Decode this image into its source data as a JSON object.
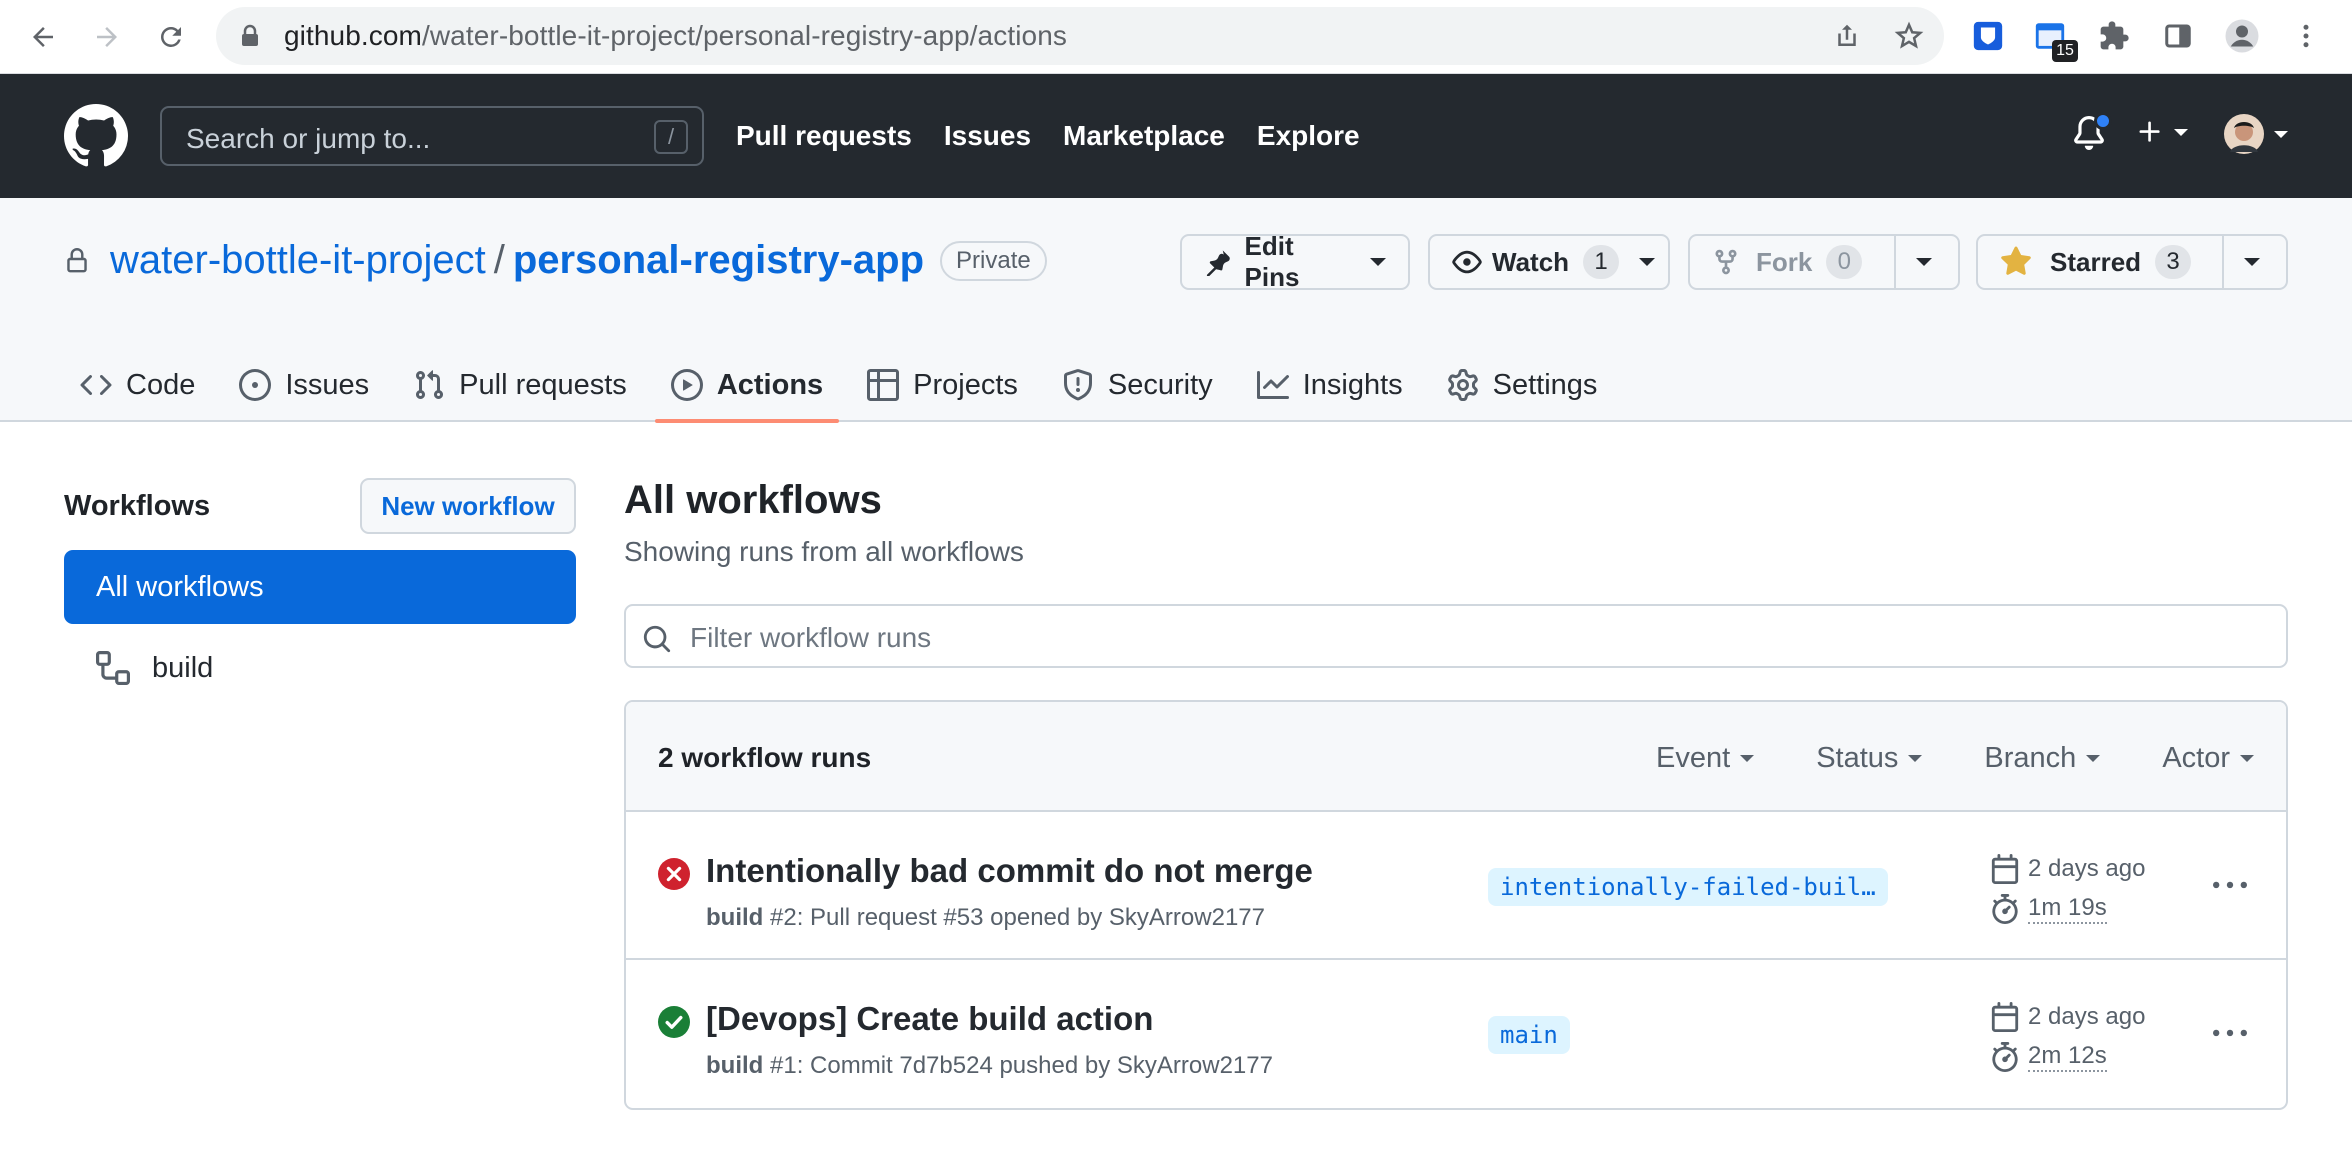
{
  "browser": {
    "url_host": "github.com",
    "url_path": "/water-bottle-it-project/personal-registry-app/actions",
    "extension_badge": "15"
  },
  "header": {
    "search_placeholder": "Search or jump to...",
    "search_shortcut": "/",
    "nav": [
      "Pull requests",
      "Issues",
      "Marketplace",
      "Explore"
    ]
  },
  "repo": {
    "owner": "water-bottle-it-project",
    "separator": "/",
    "name": "personal-registry-app",
    "visibility": "Private",
    "edit_pins_label": "Edit Pins",
    "watch_label": "Watch",
    "watch_count": "1",
    "fork_label": "Fork",
    "fork_count": "0",
    "star_label": "Starred",
    "star_count": "3",
    "tabs": [
      "Code",
      "Issues",
      "Pull requests",
      "Actions",
      "Projects",
      "Security",
      "Insights",
      "Settings"
    ],
    "active_tab": "Actions"
  },
  "sidebar": {
    "title": "Workflows",
    "new_workflow_label": "New workflow",
    "items": [
      "All workflows",
      "build"
    ]
  },
  "main": {
    "title": "All workflows",
    "subtitle": "Showing runs from all workflows",
    "filter_placeholder": "Filter workflow runs",
    "runs_count": "2 workflow runs",
    "filters": [
      "Event",
      "Status",
      "Branch",
      "Actor"
    ],
    "runs": [
      {
        "status": "failure",
        "title": "Intentionally bad commit do not merge",
        "workflow": "build",
        "detail": " #2: Pull request #53 opened by SkyArrow2177",
        "branch": "intentionally-failed-buil…",
        "when": "2 days ago",
        "duration": "1m 19s"
      },
      {
        "status": "success",
        "title": "[Devops] Create build action",
        "workflow": "build",
        "detail": " #1: Commit 7d7b524 pushed by SkyArrow2177",
        "branch": "main",
        "when": "2 days ago",
        "duration": "2m 12s"
      }
    ]
  },
  "colors": {
    "header_bg": "#24292f",
    "link": "#0969da",
    "active_tab_underline": "#fd8c73",
    "failure": "#cf222e",
    "success": "#1a7f37",
    "branch_bg": "#ddf4ff"
  }
}
